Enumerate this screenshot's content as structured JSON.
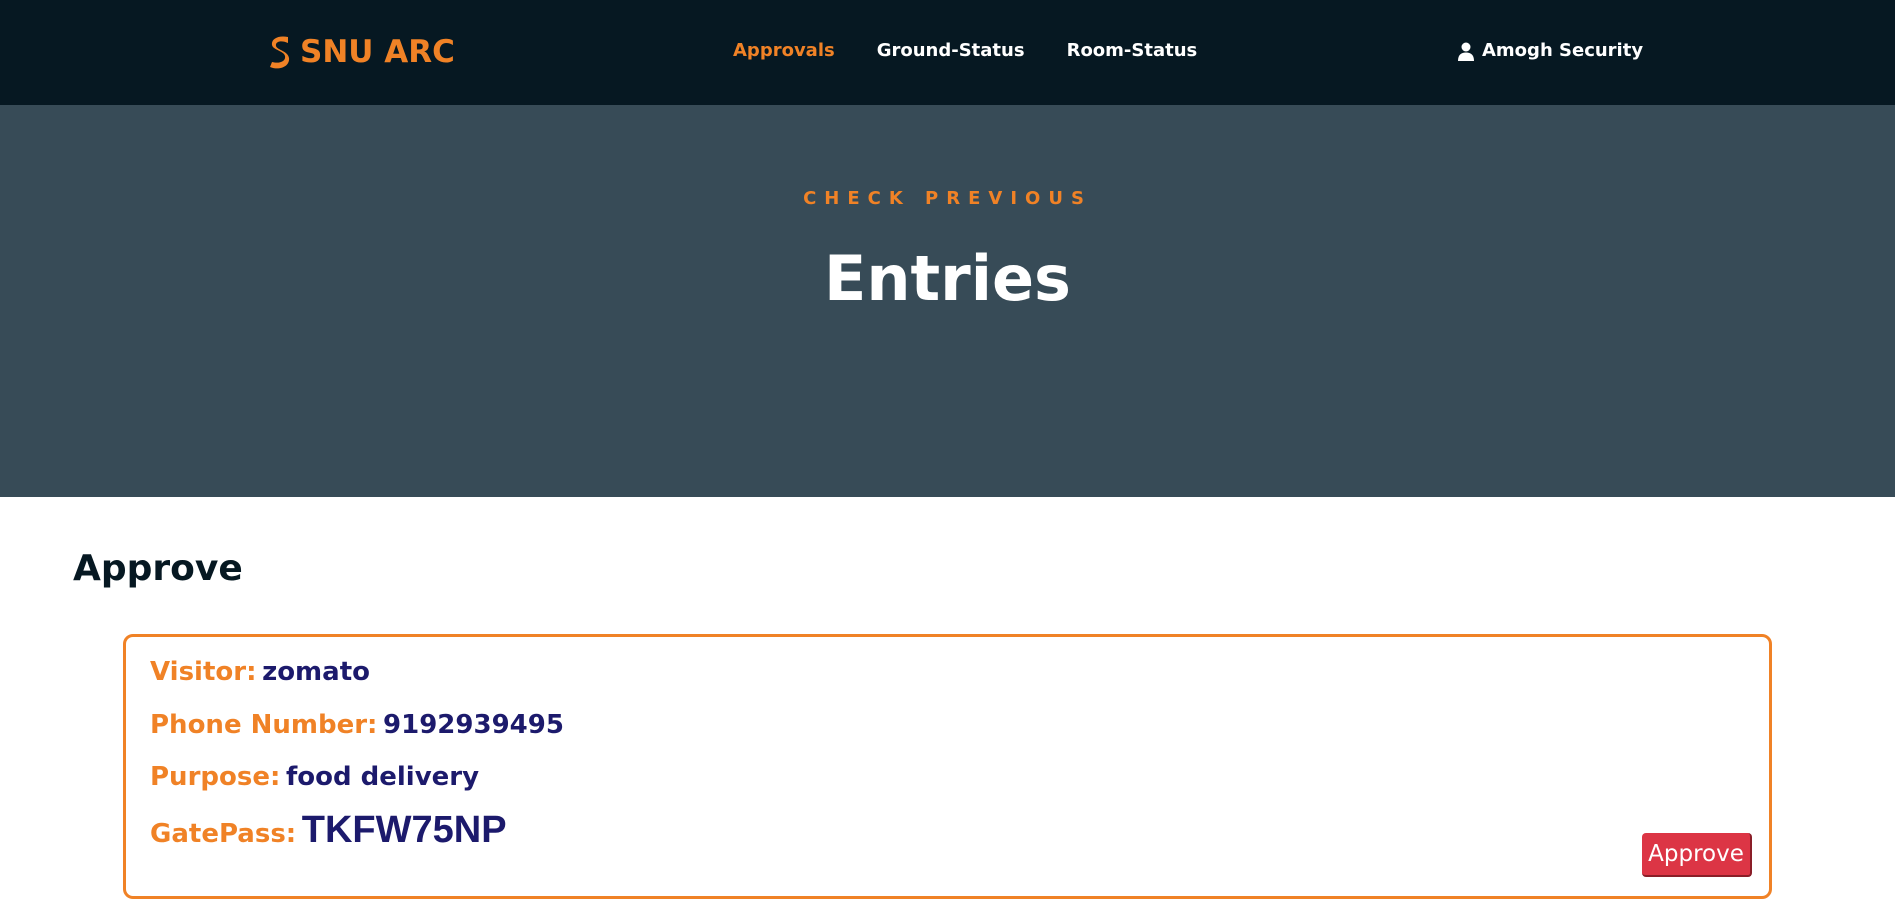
{
  "navbar": {
    "brand": "SNU ARC",
    "brand_icon": "snu-s-logo-icon",
    "links": [
      {
        "label": "Approvals",
        "active": true
      },
      {
        "label": "Ground-Status",
        "active": false
      },
      {
        "label": "Room-Status",
        "active": false
      }
    ],
    "user": {
      "icon": "user-icon",
      "name": "Amogh Security"
    }
  },
  "hero": {
    "kicker": "CHECK PREVIOUS",
    "title": "Entries"
  },
  "main": {
    "heading": "Approve",
    "entry": {
      "visitor_label": "Visitor:",
      "visitor_value": "zomato",
      "phone_label": "Phone Number:",
      "phone_value": "9192939495",
      "purpose_label": "Purpose:",
      "purpose_value": "food delivery",
      "gatepass_label": "GatePass:",
      "gatepass_value": "TKFW75NP",
      "approve_label": "Approve"
    }
  },
  "colors": {
    "navbar_bg": "#061822",
    "hero_bg": "#374b57",
    "accent": "#f08226",
    "value_text": "#1c1a6c",
    "approve_button": "#dc3545"
  }
}
